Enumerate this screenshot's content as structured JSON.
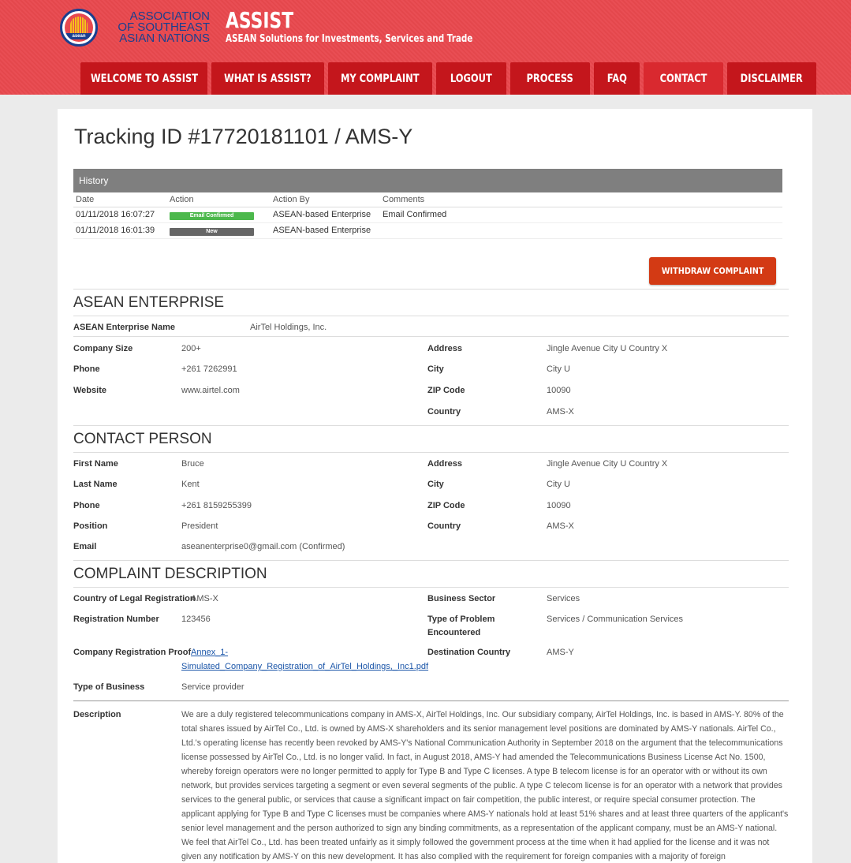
{
  "header": {
    "seal_text": "asean",
    "org_line1": "ASSOCIATION",
    "org_line2": "OF SOUTHEAST",
    "org_line3": "ASIAN NATIONS",
    "brand_title": "ASSIST",
    "brand_subtitle": "ASEAN Solutions for Investments, Services and Trade"
  },
  "nav": {
    "items": [
      "WELCOME TO ASSIST",
      "WHAT IS ASSIST?",
      "MY COMPLAINT",
      "LOGOUT",
      "PROCESS",
      "FAQ",
      "CONTACT",
      "DISCLAIMER"
    ],
    "active": "CONTACT"
  },
  "page": {
    "title": "Tracking ID #17720181101 / AMS-Y"
  },
  "history": {
    "heading": "History",
    "columns": [
      "Date",
      "Action",
      "Action By",
      "Comments"
    ],
    "rows": [
      {
        "date": "01/11/2018 16:07:27",
        "action": "Email Confirmed",
        "action_color": "#4cb84c",
        "by": "ASEAN-based Enterprise",
        "comments": "Email Confirmed"
      },
      {
        "date": "01/11/2018 16:01:39",
        "action": "New",
        "action_color": "#666666",
        "by": "ASEAN-based Enterprise",
        "comments": ""
      }
    ]
  },
  "withdraw_label": "WITHDRAW COMPLAINT",
  "enterprise": {
    "title": "ASEAN ENTERPRISE",
    "name_label": "ASEAN Enterprise Name",
    "name": "AirTel Holdings, Inc.",
    "size_label": "Company Size",
    "size": "200+",
    "phone_label": "Phone",
    "phone": "+261 7262991",
    "website_label": "Website",
    "website": "www.airtel.com",
    "address_label": "Address",
    "address": "Jingle Avenue City U Country X",
    "city_label": "City",
    "city": "City U",
    "zip_label": "ZIP Code",
    "zip": "10090",
    "country_label": "Country",
    "country": "AMS-X"
  },
  "contact": {
    "title": "CONTACT PERSON",
    "first_label": "First Name",
    "first": "Bruce",
    "last_label": "Last Name",
    "last": "Kent",
    "phone_label": "Phone",
    "phone": "+261 8159255399",
    "position_label": "Position",
    "position": "President",
    "email_label": "Email",
    "email": "aseanenterprise0@gmail.com (Confirmed)",
    "address_label": "Address",
    "address": "Jingle Avenue City U Country X",
    "city_label": "City",
    "city": "City U",
    "zip_label": "ZIP Code",
    "zip": "10090",
    "country_label": "Country",
    "country": "AMS-X"
  },
  "complaint": {
    "title": "COMPLAINT DESCRIPTION",
    "legal_country_label": "Country of Legal Registration",
    "legal_country": "AMS-X",
    "reg_number_label": "Registration Number",
    "reg_number": "123456",
    "reg_proof_label": "Company Registration Proof",
    "reg_proof_line1": "Annex_1-",
    "reg_proof_line2": "Simulated_Company_Registration_of_AirTel_Holdings,_Inc1.pdf",
    "business_type_label": "Type of Business",
    "business_type": "Service provider",
    "sector_label": "Business Sector",
    "sector": "Services",
    "problem_label_1": "Type of Problem",
    "problem_label_2": "Encountered",
    "problem": "Services / Communication Services",
    "destination_label": "Destination Country",
    "destination": "AMS-Y",
    "description_label": "Description",
    "description": "We are a duly registered telecommunications company in AMS-X, AirTel Holdings, Inc. Our subsidiary company, AirTel Holdings, Inc. is based in AMS-Y. 80% of the total shares issued by AirTel Co., Ltd. is owned by AMS-X shareholders and its senior management level positions are dominated by AMS-Y nationals. AirTel Co., Ltd.'s operating license has recently been revoked by AMS-Y's National Communication Authority in September 2018 on the argument that the telecommunications license possessed by AirTel Co., Ltd. is no longer valid. In fact, in August 2018, AMS-Y had amended the Telecommunications Business License Act No. 1500, whereby foreign operators were no longer permitted to apply for Type B and Type C licenses. A type B telecom license is for an operator with or without its own network, but provides services targeting a segment or even several segments of the public. A type C telecom license is for an operator with a network that provides services to the general public, or services that cause a significant impact on fair competition, the public interest, or require special consumer protection. The applicant applying for Type B and Type C licenses must be companies where AMS-Y nationals hold at least 51% shares and at least three quarters of the applicant's senior level management and the person authorized to sign any binding commitments, as a representation of the applicant company, must be an AMS-Y national. We feel that AirTel Co., Ltd. has been treated unfairly as it simply followed the government process at the time when it had applied for the license and it was not given any notification by AMS-Y on this new development. It has also complied with the requirement for foreign companies with a majority of foreign"
  }
}
